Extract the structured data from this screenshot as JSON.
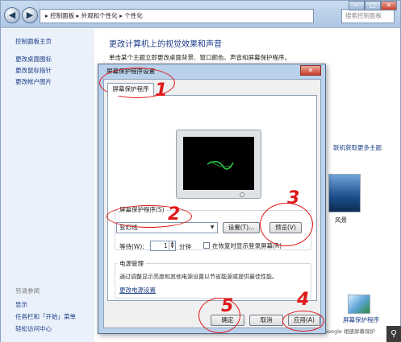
{
  "window": {
    "address_path": "▸ 控制面板 ▸ 外观和个性化 ▸ 个性化",
    "search_placeholder": "搜索控制面板",
    "caption_minimize": "─",
    "caption_maximize": "□",
    "caption_close": "✕"
  },
  "sidebar": {
    "home": "控制面板主页",
    "links": [
      "更改桌面图标",
      "更改鼠标指针",
      "更改帐户图片"
    ],
    "see_also_heading": "另请参阅",
    "see_also": [
      "显示",
      "任务栏和「开始」菜单",
      "轻松访问中心"
    ]
  },
  "main": {
    "title": "更改计算机上的视觉效果和声音",
    "subtitle": "单击某个主题立即更改桌面背景、窗口颜色、声音和屏幕保护程序。",
    "online_themes_link": "联机获取更多主题",
    "theme_label": "风景",
    "screensaver_label": "屏幕保护程序",
    "google_label": "Google 相册屏幕保护"
  },
  "dialog": {
    "title": "屏幕保护程序设置",
    "tab": "屏幕保护程序",
    "screensaver_group": "屏幕保护程序(S)",
    "screensaver_selected": "变幻线",
    "settings_button": "设置(T)...",
    "preview_button": "预览(V)",
    "wait_label": "等待(W):",
    "wait_value": "1",
    "minutes_label": "分钟",
    "resume_logon_label": "在恢复时显示登录屏幕(R)",
    "power_group": "电源管理",
    "power_text": "通过调整显示亮度和其他电源设置以节省能源或提供最佳性能。",
    "power_link": "更改电源设置",
    "ok_button": "确定",
    "cancel_button": "取消",
    "apply_button": "应用(A)"
  },
  "annotations": [
    "1",
    "2",
    "3",
    "4",
    "5"
  ],
  "colors": {
    "annotation": "#e01818",
    "link": "#1b3d87",
    "title_blue": "#1e3c8c"
  }
}
